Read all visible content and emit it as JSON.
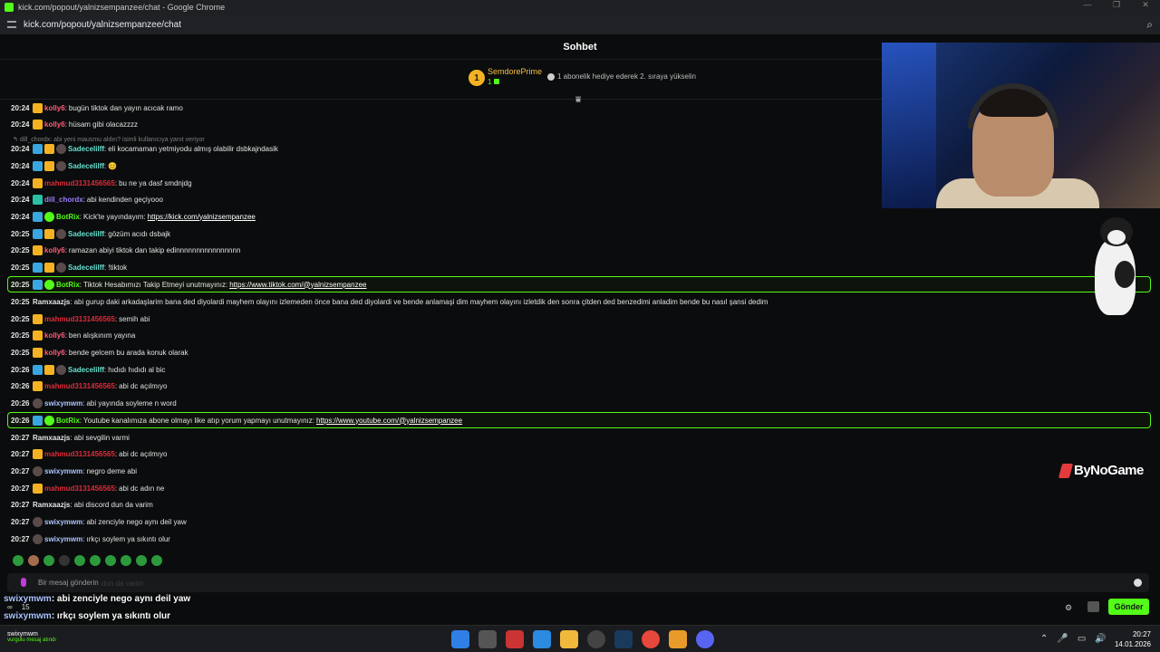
{
  "window": {
    "title": "kick.com/popout/yalnizsempanzee/chat - Google Chrome",
    "url": "kick.com/popout/yalnizsempanzee/chat"
  },
  "chat_header": {
    "title": "Sohbet"
  },
  "pinned": {
    "rank": "1",
    "top_user": "SemdorePrime",
    "top_count": "1",
    "gift_info": "1 abonelik hediye ederek 2. sıraya yükselin"
  },
  "reply_hint": "dill_chordx: abi yeni mausmu aldın? isimli kullanıcıya yanıt veriyor",
  "messages": [
    {
      "time": "20:24",
      "user": "kolly6",
      "color": "#ff5c7a",
      "badges": [
        "crown"
      ],
      "text": "bugün tiktok dan yayın acıcak ramo"
    },
    {
      "time": "20:24",
      "user": "kolly6",
      "color": "#ff5c7a",
      "badges": [
        "crown"
      ],
      "text": "hüsam gibi olacazzzz"
    },
    {
      "time": "20:24",
      "user": "Sadecelilff",
      "color": "#67e0d0",
      "badges": [
        "mod",
        "crown",
        "sub"
      ],
      "text": "eli kocamaman yetmiyodu almış olabilir dsbkajndasik"
    },
    {
      "time": "20:24",
      "user": "Sadecelilff",
      "color": "#67e0d0",
      "badges": [
        "mod",
        "crown",
        "sub"
      ],
      "text": "😊"
    },
    {
      "time": "20:24",
      "user": "mahmud3131456565",
      "color": "#e02b3a",
      "badges": [
        "crown"
      ],
      "text": "bu ne ya dasf smdnjdg"
    },
    {
      "time": "20:24",
      "user": "dill_chordx",
      "color": "#9b7dff",
      "badges": [
        "og"
      ],
      "text": "abi kendinden geçiyooo"
    },
    {
      "time": "20:24",
      "user": "BotRix",
      "color": "#53fc18",
      "badges": [
        "mod",
        "bot"
      ],
      "text": "Kick'te yayındayım:",
      "link": "https://kick.com/yalnizsempanzee"
    },
    {
      "time": "20:25",
      "user": "Sadecelilff",
      "color": "#67e0d0",
      "badges": [
        "mod",
        "crown",
        "sub"
      ],
      "text": "gözüm acıdı dsbajk"
    },
    {
      "time": "20:25",
      "user": "kolly6",
      "color": "#ff5c7a",
      "badges": [
        "crown"
      ],
      "text": "ramazan abiyi tiktok dan takip edinnnnnnnnnnnnnnnn"
    },
    {
      "time": "20:25",
      "user": "Sadecelilff",
      "color": "#67e0d0",
      "badges": [
        "mod",
        "crown",
        "sub"
      ],
      "text": "!tiktok"
    },
    {
      "time": "20:25",
      "user": "BotRix",
      "color": "#53fc18",
      "badges": [
        "mod",
        "bot"
      ],
      "text": "Tiktok Hesabımızı Takip Etmeyi unutmayınız:",
      "link": "https://www.tiktok.com/@yalnizsempanzee",
      "highlight": true
    },
    {
      "time": "20:25",
      "user": "Ramxaazjs",
      "color": "#e6e6e6",
      "badges": [],
      "text": "abi gurup daki arkadaşlarim bana ded diyolardi mayhem olayını izlemeden önce bana ded diyolardi ve bende anlamaşi dim mayhem olayını izletdik den sonra çitden ded benzedimi anladim bende bu nasıl şansi dedim"
    },
    {
      "time": "20:25",
      "user": "mahmud3131456565",
      "color": "#e02b3a",
      "badges": [
        "crown"
      ],
      "text": "semih abi"
    },
    {
      "time": "20:25",
      "user": "kolly6",
      "color": "#ff5c7a",
      "badges": [
        "crown"
      ],
      "text": "ben alışkınım yayına"
    },
    {
      "time": "20:25",
      "user": "kolly6",
      "color": "#ff5c7a",
      "badges": [
        "crown"
      ],
      "text": "bende gelcem bu arada konuk olarak"
    },
    {
      "time": "20:26",
      "user": "Sadecelilff",
      "color": "#67e0d0",
      "badges": [
        "mod",
        "crown",
        "sub"
      ],
      "text": "hıdıdı hıdıdı al bic"
    },
    {
      "time": "20:26",
      "user": "mahmud3131456565",
      "color": "#e02b3a",
      "badges": [
        "crown"
      ],
      "text": "abi dc açılmıyo"
    },
    {
      "time": "20:26",
      "user": "swixymwm",
      "color": "#aac4ff",
      "badges": [
        "sub"
      ],
      "text": "abi yayında soyleme n word"
    },
    {
      "time": "20:26",
      "user": "BotRix",
      "color": "#53fc18",
      "badges": [
        "mod",
        "bot"
      ],
      "text": "Youtube kanalımıza abone olmayı like atıp yorum yapmayı unutmayınız:",
      "link": "https://www.youtube.com/@yalnizsempanzee",
      "highlight": true
    },
    {
      "time": "20:27",
      "user": "Ramxaazjs",
      "color": "#e6e6e6",
      "badges": [],
      "text": "abi sevgilin varmi"
    },
    {
      "time": "20:27",
      "user": "mahmud3131456565",
      "color": "#e02b3a",
      "badges": [
        "crown"
      ],
      "text": "abi dc açılmıyo"
    },
    {
      "time": "20:27",
      "user": "swixymwm",
      "color": "#aac4ff",
      "badges": [
        "sub"
      ],
      "text": "negro deme abi"
    },
    {
      "time": "20:27",
      "user": "mahmud3131456565",
      "color": "#e02b3a",
      "badges": [
        "crown"
      ],
      "text": "abi dc adın ne"
    },
    {
      "time": "20:27",
      "user": "Ramxaazjs",
      "color": "#e6e6e6",
      "badges": [],
      "text": "abi discord dun da varim"
    },
    {
      "time": "20:27",
      "user": "swixymwm",
      "color": "#aac4ff",
      "badges": [
        "sub"
      ],
      "text": "abi zenciyle nego aynı deil yaw"
    },
    {
      "time": "20:27",
      "user": "swixymwm",
      "color": "#aac4ff",
      "badges": [
        "sub"
      ],
      "text": "ırkçı soylem ya sıkıntı olur"
    }
  ],
  "input": {
    "placeholder": "Bir mesaj gönderin",
    "ghost_text": "dun da varim",
    "send_label": "Gönder"
  },
  "counters": {
    "viewers": "∞",
    "count": "15"
  },
  "overlay": [
    {
      "user": "swixymwm",
      "text": ": abi zenciyle nego aynı deil yaw"
    },
    {
      "user": "swixymwm",
      "text": ": ırkçı soylem ya sıkıntı olur"
    }
  ],
  "watermark": "ByNoGame",
  "taskbar": {
    "user": "swixymwm",
    "status": "vurgulu mesaj atındı",
    "time": "20:27",
    "date": "14.01.2026"
  }
}
